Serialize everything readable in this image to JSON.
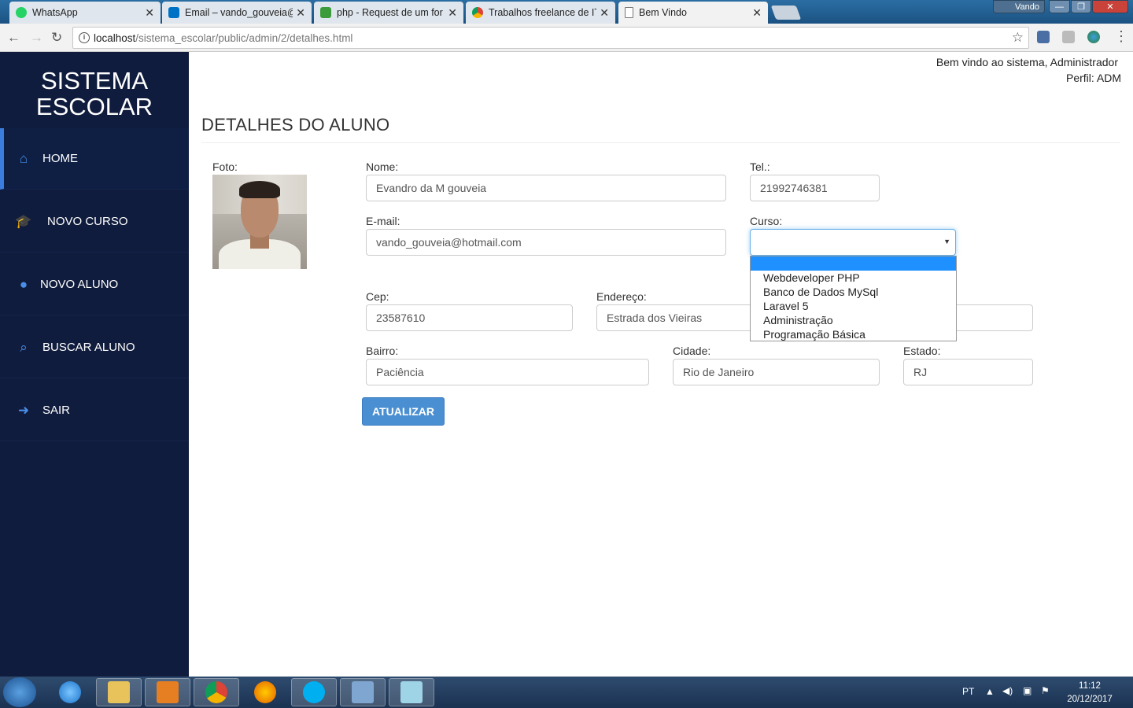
{
  "browser": {
    "tabs": [
      {
        "title": "WhatsApp",
        "icon": "whatsapp-icon",
        "color": "#25d366"
      },
      {
        "title": "Email – vando_gouveia@",
        "icon": "outlook-icon",
        "color": "#0072c6"
      },
      {
        "title": "php - Request de um for",
        "icon": "stackoverflow-icon",
        "color": "#3c9c3c"
      },
      {
        "title": "Trabalhos freelance de IT",
        "icon": "chrome-tab-icon",
        "color": "#c0392b"
      },
      {
        "title": "Bem Vindo",
        "icon": "page-icon",
        "color": "#ffffff"
      }
    ],
    "window_user": "Vando",
    "url_host": "localhost",
    "url_path": "/sistema_escolar/public/admin/2/detalhes.html"
  },
  "app": {
    "logo_line1": "SISTEMA",
    "logo_line2": "ESCOLAR",
    "menu": [
      {
        "label": "HOME",
        "icon": "home-icon"
      },
      {
        "label": "NOVO CURSO",
        "icon": "graduation-cap-icon"
      },
      {
        "label": "NOVO ALUNO",
        "icon": "user-icon"
      },
      {
        "label": "BUSCAR ALUNO",
        "icon": "search-icon"
      },
      {
        "label": "SAIR",
        "icon": "sign-out-icon"
      }
    ],
    "welcome": "Bem vindo ao sistema, Administrador",
    "profile": "Perfil: ADM",
    "page_title": "DETALHES DO ALUNO",
    "accent": "#3b7ddd"
  },
  "form": {
    "foto_label": "Foto:",
    "nome_label": "Nome:",
    "nome_value": "Evandro da M gouveia",
    "tel_label": "Tel.:",
    "tel_value": "21992746381",
    "email_label": "E-mail:",
    "email_value": "vando_gouveia@hotmail.com",
    "curso_label": "Curso:",
    "curso_value": "",
    "curso_options": [
      "",
      "Webdeveloper PHP",
      "Banco de Dados MySql",
      "Laravel 5",
      "Administração",
      "Programação Básica"
    ],
    "cep_label": "Cep:",
    "cep_value": "23587610",
    "endereco_label": "Endereço:",
    "endereco_value": "Estrada dos Vieiras",
    "bairro_label": "Bairro:",
    "bairro_value": "Paciência",
    "cidade_label": "Cidade:",
    "cidade_value": "Rio de Janeiro",
    "estado_label": "Estado:",
    "estado_value": "RJ",
    "submit_label": "ATUALIZAR"
  },
  "taskbar": {
    "language": "PT",
    "time": "11:12",
    "date": "20/12/2017"
  }
}
